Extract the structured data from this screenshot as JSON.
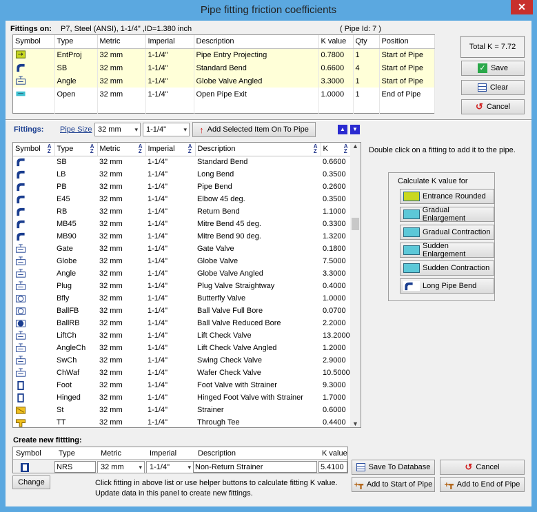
{
  "window": {
    "title": "Pipe fitting friction coefficients",
    "close": "✕"
  },
  "fittings_on": {
    "label": "Fittings on:",
    "pipe": "P7, Steel (ANSI), 1-1/4\" ,ID=1.380 inch",
    "pipe_id": "( Pipe Id: 7 )"
  },
  "pipe_columns": [
    "Symbol",
    "Type",
    "Metric",
    "Imperial",
    "Description",
    "K value",
    "Qty",
    "Position"
  ],
  "pipe_rows": [
    {
      "icon": "entry-projecting-icon",
      "type": "EntProj",
      "metric": "32 mm",
      "imperial": "1-1/4\"",
      "desc": "Pipe Entry Projecting",
      "k": "0.7800",
      "qty": "1",
      "pos": "Start of Pipe"
    },
    {
      "icon": "standard-bend-icon",
      "type": "SB",
      "metric": "32 mm",
      "imperial": "1-1/4\"",
      "desc": "Standard Bend",
      "k": "0.6600",
      "qty": "4",
      "pos": "Start of Pipe"
    },
    {
      "icon": "globe-valve-angled-icon",
      "type": "Angle",
      "metric": "32 mm",
      "imperial": "1-1/4\"",
      "desc": "Globe Valve Angled",
      "k": "3.3000",
      "qty": "1",
      "pos": "Start of Pipe"
    },
    {
      "icon": "open-pipe-exit-icon",
      "type": "Open",
      "metric": "32 mm",
      "imperial": "1-1/4\"",
      "desc": "Open Pipe Exit",
      "k": "1.0000",
      "qty": "1",
      "pos": "End of Pipe"
    }
  ],
  "total_k": "Total K = 7.72",
  "buttons": {
    "save": "Save",
    "clear": "Clear",
    "cancel": "Cancel"
  },
  "fittings_bar": {
    "label": "Fittings:",
    "pipe_size": "Pipe Size",
    "metric": "32 mm",
    "imperial": "1-1/4\"",
    "add": "Add Selected Item On To Pipe"
  },
  "list_columns": [
    "Symbol",
    "Type",
    "Metric",
    "Imperial",
    "Description",
    "K"
  ],
  "list_rows": [
    {
      "icon": "standard-bend-icon",
      "type": "SB",
      "metric": "32 mm",
      "imperial": "1-1/4\"",
      "desc": "Standard Bend",
      "k": "0.6600"
    },
    {
      "icon": "long-bend-icon",
      "type": "LB",
      "metric": "32 mm",
      "imperial": "1-1/4\"",
      "desc": "Long Bend",
      "k": "0.3500"
    },
    {
      "icon": "pipe-bend-icon",
      "type": "PB",
      "metric": "32 mm",
      "imperial": "1-1/4\"",
      "desc": "Pipe Bend",
      "k": "0.2600"
    },
    {
      "icon": "elbow-45-icon",
      "type": "E45",
      "metric": "32 mm",
      "imperial": "1-1/4\"",
      "desc": "Elbow 45 deg.",
      "k": "0.3500"
    },
    {
      "icon": "return-bend-icon",
      "type": "RB",
      "metric": "32 mm",
      "imperial": "1-1/4\"",
      "desc": "Return Bend",
      "k": "1.1000"
    },
    {
      "icon": "mitre-bend-45-icon",
      "type": "MB45",
      "metric": "32 mm",
      "imperial": "1-1/4\"",
      "desc": "Mitre Bend 45 deg.",
      "k": "0.3300"
    },
    {
      "icon": "mitre-bend-90-icon",
      "type": "MB90",
      "metric": "32 mm",
      "imperial": "1-1/4\"",
      "desc": "Mitre Bend 90 deg.",
      "k": "1.3200"
    },
    {
      "icon": "gate-valve-icon",
      "type": "Gate",
      "metric": "32 mm",
      "imperial": "1-1/4\"",
      "desc": "Gate Valve",
      "k": "0.1800"
    },
    {
      "icon": "globe-valve-icon",
      "type": "Globe",
      "metric": "32 mm",
      "imperial": "1-1/4\"",
      "desc": "Globe Valve",
      "k": "7.5000"
    },
    {
      "icon": "globe-valve-angled-icon",
      "type": "Angle",
      "metric": "32 mm",
      "imperial": "1-1/4\"",
      "desc": "Globe Valve Angled",
      "k": "3.3000"
    },
    {
      "icon": "plug-valve-icon",
      "type": "Plug",
      "metric": "32 mm",
      "imperial": "1-1/4\"",
      "desc": "Plug Valve Straightway",
      "k": "0.4000"
    },
    {
      "icon": "butterfly-valve-icon",
      "type": "Bfly",
      "metric": "32 mm",
      "imperial": "1-1/4\"",
      "desc": "Butterfly Valve",
      "k": "1.0000"
    },
    {
      "icon": "ball-valve-full-icon",
      "type": "BallFB",
      "metric": "32 mm",
      "imperial": "1-1/4\"",
      "desc": "Ball Valve Full Bore",
      "k": "0.0700"
    },
    {
      "icon": "ball-valve-reduced-icon",
      "type": "BallRB",
      "metric": "32 mm",
      "imperial": "1-1/4\"",
      "desc": "Ball Valve Reduced Bore",
      "k": "2.2000"
    },
    {
      "icon": "lift-check-valve-icon",
      "type": "LiftCh",
      "metric": "32 mm",
      "imperial": "1-1/4\"",
      "desc": "Lift Check Valve",
      "k": "13.2000"
    },
    {
      "icon": "lift-check-angled-icon",
      "type": "AngleCh",
      "metric": "32 mm",
      "imperial": "1-1/4\"",
      "desc": "Lift Check Valve Angled",
      "k": "1.2000"
    },
    {
      "icon": "swing-check-valve-icon",
      "type": "SwCh",
      "metric": "32 mm",
      "imperial": "1-1/4\"",
      "desc": "Swing Check Valve",
      "k": "2.9000"
    },
    {
      "icon": "wafer-check-valve-icon",
      "type": "ChWaf",
      "metric": "32 mm",
      "imperial": "1-1/4\"",
      "desc": "Wafer Check Valve",
      "k": "10.5000"
    },
    {
      "icon": "foot-valve-icon",
      "type": "Foot",
      "metric": "32 mm",
      "imperial": "1-1/4\"",
      "desc": "Foot Valve with Strainer",
      "k": "9.3000"
    },
    {
      "icon": "hinged-foot-valve-icon",
      "type": "Hinged",
      "metric": "32 mm",
      "imperial": "1-1/4\"",
      "desc": "Hinged Foot Valve with Strainer",
      "k": "1.7000"
    },
    {
      "icon": "strainer-icon",
      "type": "St",
      "metric": "32 mm",
      "imperial": "1-1/4\"",
      "desc": "Strainer",
      "k": "0.6000"
    },
    {
      "icon": "through-tee-icon",
      "type": "TT",
      "metric": "32 mm",
      "imperial": "1-1/4\"",
      "desc": "Through Tee",
      "k": "0.4400"
    }
  ],
  "hint": "Double click on a fitting to add it to the pipe.",
  "calc": {
    "title": "Calculate K value for",
    "buttons": [
      "Entrance Rounded",
      "Gradual Enlargement",
      "Gradual Contraction",
      "Sudden Enlargement",
      "Sudden Contraction",
      "Long Pipe Bend"
    ]
  },
  "create": {
    "label": "Create new fittting:",
    "columns": [
      "Symbol",
      "Type",
      "Metric",
      "Imperial",
      "Description",
      "K value"
    ],
    "type": "NRS",
    "metric": "32 mm",
    "imperial": "1-1/4\"",
    "desc": "Non-Return Strainer",
    "k": "5.4100",
    "change": "Change",
    "save_db": "Save To Database",
    "cancel": "Cancel",
    "add_start": "Add to Start of Pipe",
    "add_end": "Add to End of Pipe",
    "help1": "Click fitting in above list or use helper buttons to calculate fitting K value.",
    "help2": "Update data in this panel to create new fittings."
  },
  "colors": {
    "title_bar": "#5ba8e0",
    "highlight_row": "#ffffd8",
    "close": "#c8302c"
  }
}
